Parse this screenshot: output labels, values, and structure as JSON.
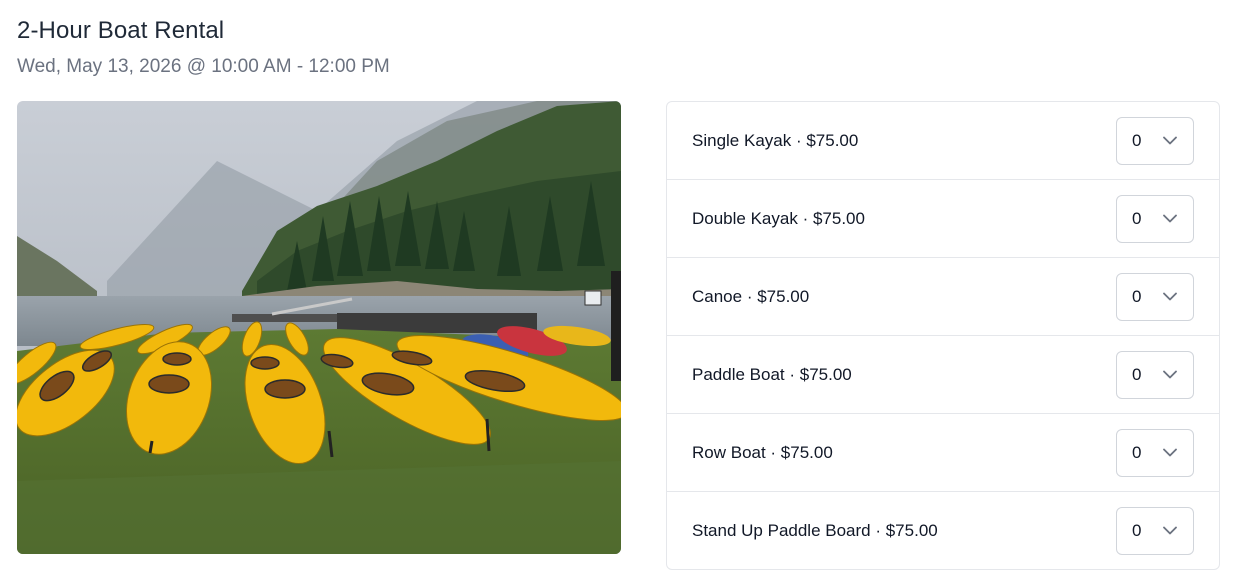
{
  "header": {
    "title": "2-Hour Boat Rental",
    "datetime": "Wed, May 13, 2026 @ 10:00 AM - 12:00 PM"
  },
  "photo": {
    "icon": "photo-kayaks-on-grass"
  },
  "items": [
    {
      "label": "Single Kayak · $75.00",
      "quantity": "0"
    },
    {
      "label": "Double Kayak · $75.00",
      "quantity": "0"
    },
    {
      "label": "Canoe · $75.00",
      "quantity": "0"
    },
    {
      "label": "Paddle Boat · $75.00",
      "quantity": "0"
    },
    {
      "label": "Row Boat · $75.00",
      "quantity": "0"
    },
    {
      "label": "Stand Up Paddle Board · $75.00",
      "quantity": "0"
    }
  ],
  "colors": {
    "kayak": "#f2b90c",
    "grass": "#56702e",
    "border": "#e5e7eb"
  }
}
